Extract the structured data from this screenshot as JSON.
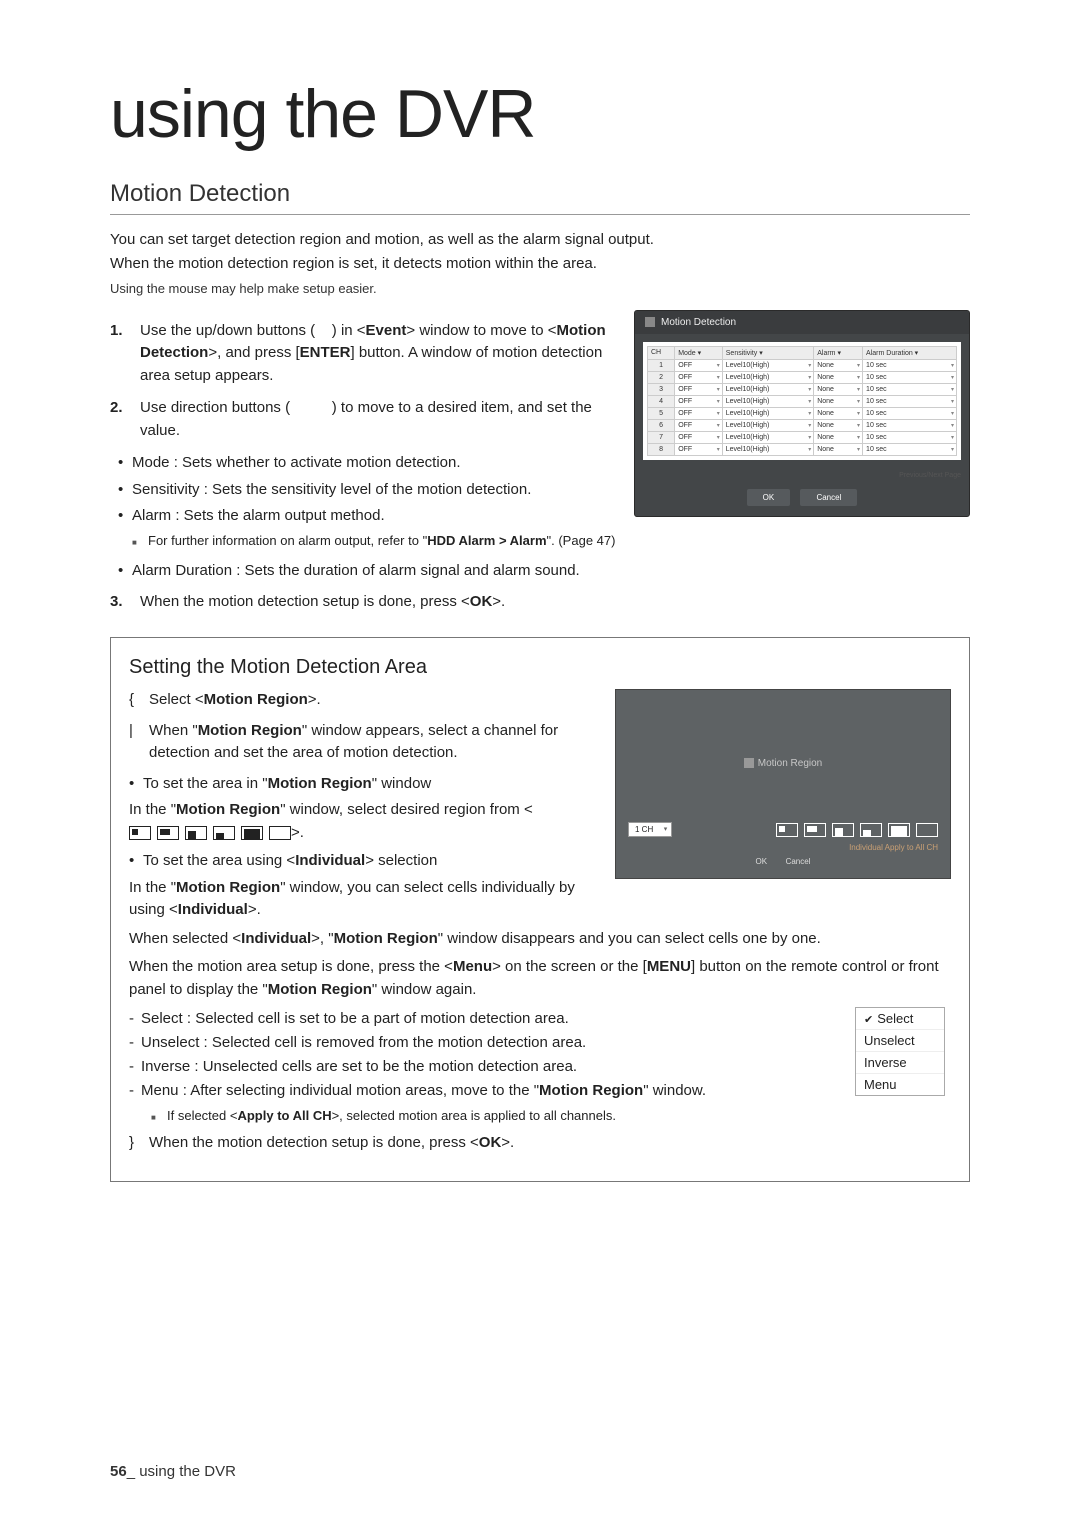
{
  "chapter_title": "using the DVR",
  "section_title": "Motion Detection",
  "intro_p1": "You can set target detection region and motion, as well as the alarm signal output.",
  "intro_p2": "When the motion detection region is set, it detects motion within the area.",
  "intro_note": "Using the mouse may help make setup easier.",
  "step1_num": "1.",
  "step1_a": "Use the up/down buttons (    ) in <",
  "step1_b": "Event",
  "step1_c": "> window to move to <",
  "step1_d": "Motion Detection",
  "step1_e": ">, and press [",
  "step1_f": "ENTER",
  "step1_g": "] button. A window of motion detection area setup appears.",
  "step2_num": "2.",
  "step2_a": "Use direction buttons (          ) to move to a desired item, and set the value.",
  "b_mode": "Mode : Sets whether to activate motion detection.",
  "b_sens": "Sensitivity : Sets the sensitivity level of the motion detection.",
  "b_alarm": "Alarm : Sets the alarm output method.",
  "sub_alarm_a": "For further information on alarm output, refer to \"",
  "sub_alarm_b": "HDD Alarm > Alarm",
  "sub_alarm_c": "\". (Page 47)",
  "b_dur": "Alarm Duration : Sets the duration of alarm signal and alarm sound.",
  "step3_num": "3.",
  "step3_a": "When the motion detection setup is done, press <",
  "step3_b": "OK",
  "step3_c": ">.",
  "dvr": {
    "title": "Motion Detection",
    "cols": {
      "ch": "CH",
      "mode": "Mode ▾",
      "sens": "Sensitivity ▾",
      "alarm": "Alarm ▾",
      "dur": "Alarm Duration ▾"
    },
    "rows": [
      {
        "ch": "1",
        "mode": "OFF",
        "sens": "Level10(High)",
        "alarm": "None",
        "dur": "10 sec"
      },
      {
        "ch": "2",
        "mode": "OFF",
        "sens": "Level10(High)",
        "alarm": "None",
        "dur": "10 sec"
      },
      {
        "ch": "3",
        "mode": "OFF",
        "sens": "Level10(High)",
        "alarm": "None",
        "dur": "10 sec"
      },
      {
        "ch": "4",
        "mode": "OFF",
        "sens": "Level10(High)",
        "alarm": "None",
        "dur": "10 sec"
      },
      {
        "ch": "5",
        "mode": "OFF",
        "sens": "Level10(High)",
        "alarm": "None",
        "dur": "10 sec"
      },
      {
        "ch": "6",
        "mode": "OFF",
        "sens": "Level10(High)",
        "alarm": "None",
        "dur": "10 sec"
      },
      {
        "ch": "7",
        "mode": "OFF",
        "sens": "Level10(High)",
        "alarm": "None",
        "dur": "10 sec"
      },
      {
        "ch": "8",
        "mode": "OFF",
        "sens": "Level10(High)",
        "alarm": "None",
        "dur": "10 sec"
      }
    ],
    "pager": "Previous/Next Page",
    "ok": "OK",
    "cancel": "Cancel"
  },
  "box": {
    "title": "Setting the Motion Detection Area",
    "s1_m": "{",
    "s1_a": "Select <",
    "s1_b": "Motion Region",
    "s1_c": ">.",
    "s2_m": "|",
    "s2_a": "When \"",
    "s2_b": "Motion Region",
    "s2_c": "\" window appears, select a channel for detection and set the area of motion detection.",
    "bb1_a": "To set the area in \"",
    "bb1_b": "Motion Region",
    "bb1_c": "\" window",
    "p1_a": "In the \"",
    "p1_b": "Motion Region",
    "p1_c": "\" window, select desired region from <",
    "p1_d": ">.",
    "bb2_a": "To set the area using <",
    "bb2_b": "Individual",
    "bb2_c": "> selection",
    "p2_a": "In the \"",
    "p2_b": "Motion Region",
    "p2_c": "\" window, you can select cells individually by using <",
    "p2_d": "Individual",
    "p2_e": ">.",
    "p3_a": "When selected <",
    "p3_b": "Individual",
    "p3_c": ">, \"",
    "p3_d": "Motion Region",
    "p3_e": "\" window disappears and you can select cells one by one.",
    "p4_a": "When the motion area setup is done, press the <",
    "p4_b": "Menu",
    "p4_c": "> on the screen or the [",
    "p4_d": "MENU",
    "p4_e": "] button on the remote control or front panel to display the \"",
    "p4_f": "Motion Region",
    "p4_g": "\" window again.",
    "d1": "Select : Selected cell is set to be a part of motion detection area.",
    "d2": "Unselect : Selected cell is removed from the motion detection area.",
    "d3": "Inverse : Unselected cells are set to be the motion detection area.",
    "d4_a": "Menu : After selecting individual motion areas, move to the \"",
    "d4_b": "Motion Region",
    "d4_c": "\" window.",
    "sub2_a": "If selected <",
    "sub2_b": "Apply to All CH",
    "sub2_c": ">, selected motion area is applied to all channels.",
    "s3_m": "}",
    "s3_a": "When the motion detection setup is done, press <",
    "s3_b": "OK",
    "s3_c": ">."
  },
  "mr": {
    "title": "Motion Region",
    "channel": "1 CH",
    "hint": "Individual     Apply to All CH",
    "ok": "OK",
    "cancel": "Cancel"
  },
  "ctx": {
    "select": "Select",
    "unselect": "Unselect",
    "inverse": "Inverse",
    "menu": "Menu"
  },
  "footer": {
    "page": "56",
    "sep": "_",
    "text": " using the DVR"
  }
}
